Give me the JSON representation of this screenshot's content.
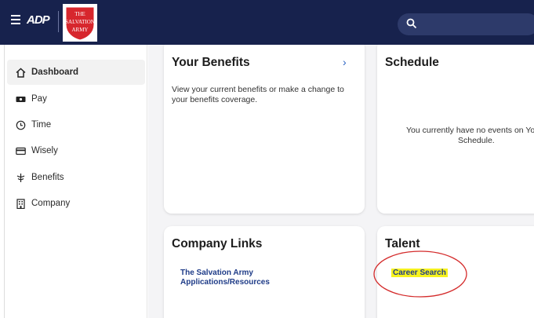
{
  "topbar": {
    "adp_logo": "ADP",
    "partner_logo_text": [
      "THE",
      "SALVATION",
      "ARMY"
    ]
  },
  "sidebar": {
    "items": [
      {
        "label": "Dashboard",
        "icon": "home-icon",
        "active": true
      },
      {
        "label": "Pay",
        "icon": "cash-icon"
      },
      {
        "label": "Time",
        "icon": "clock-icon"
      },
      {
        "label": "Wisely",
        "icon": "card-icon"
      },
      {
        "label": "Benefits",
        "icon": "benefits-icon"
      },
      {
        "label": "Company",
        "icon": "building-icon"
      }
    ]
  },
  "cards": {
    "benefits": {
      "title": "Your Benefits",
      "text": "View your current benefits or make a change to your benefits coverage."
    },
    "schedule": {
      "title": "Schedule",
      "empty_text_line1": "You currently have no events on You",
      "empty_text_line2": "Schedule."
    },
    "company_links": {
      "title": "Company Links",
      "link_line1": "The Salvation Army",
      "link_line2": "Applications/Resources"
    },
    "talent": {
      "title": "Talent",
      "link": "Career Search"
    }
  },
  "colors": {
    "topbar": "#17224d",
    "link": "#1f3c88",
    "highlight": "#f6f21e",
    "annotation": "#d42b2b"
  }
}
